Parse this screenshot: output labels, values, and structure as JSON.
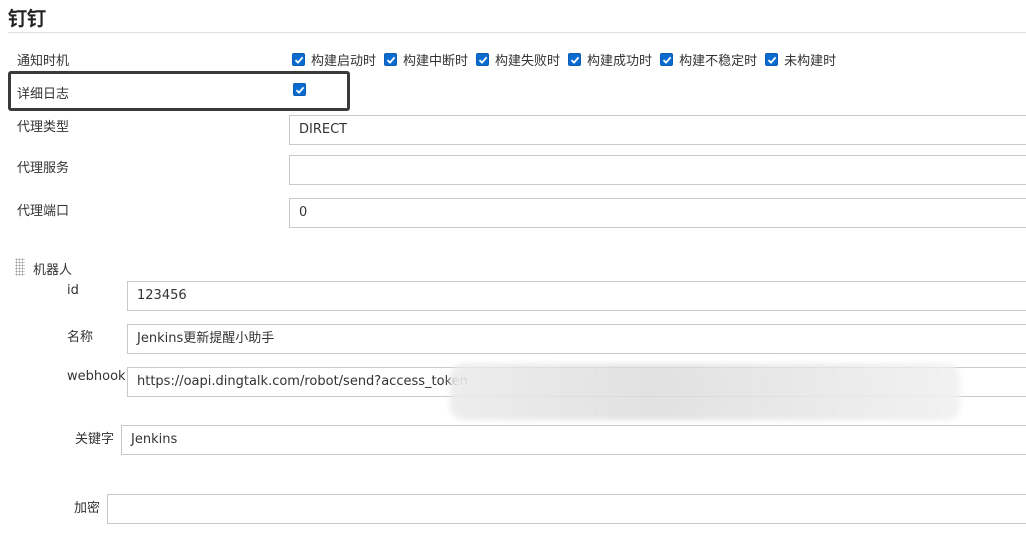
{
  "section": {
    "title": "钉钉"
  },
  "notify": {
    "label": "通知时机",
    "options": [
      {
        "label": "构建启动时",
        "checked": true
      },
      {
        "label": "构建中断时",
        "checked": true
      },
      {
        "label": "构建失败时",
        "checked": true
      },
      {
        "label": "构建成功时",
        "checked": true
      },
      {
        "label": "构建不稳定时",
        "checked": true
      },
      {
        "label": "未构建时",
        "checked": true
      }
    ]
  },
  "verbose": {
    "label": "详细日志",
    "checked": true
  },
  "proxy": {
    "type_label": "代理类型",
    "type_value": "DIRECT",
    "server_label": "代理服务",
    "server_value": "",
    "port_label": "代理端口",
    "port_value": "0"
  },
  "robot": {
    "label": "机器人",
    "id_label": "id",
    "id_value": "123456",
    "name_label": "名称",
    "name_value": "Jenkins更新提醒小助手",
    "webhook_label": "webhook",
    "webhook_value": "https://oapi.dingtalk.com/robot/send?access_token",
    "keyword_label": "关键字",
    "keyword_value": "Jenkins",
    "secret_label": "加密",
    "secret_value": ""
  },
  "colors": {
    "checkbox": "#0a6ccf",
    "highlight_border": "#3a3a3a"
  }
}
